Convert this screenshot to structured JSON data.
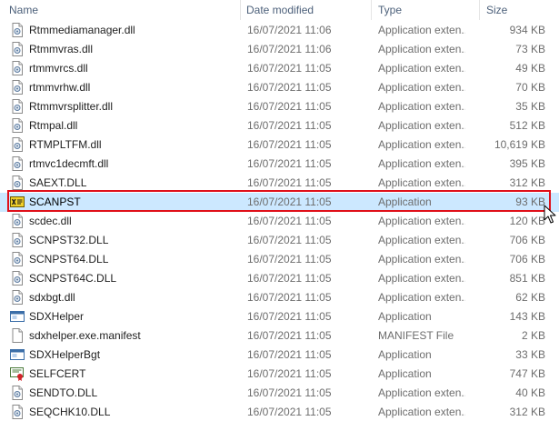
{
  "columns": {
    "name": "Name",
    "date": "Date modified",
    "type": "Type",
    "size": "Size"
  },
  "files": [
    {
      "name": "Rtmmediamanager.dll",
      "date": "16/07/2021 11:06",
      "type": "Application exten...",
      "size": "934 KB",
      "icon": "dll-gear-icon"
    },
    {
      "name": "Rtmmvras.dll",
      "date": "16/07/2021 11:06",
      "type": "Application exten...",
      "size": "73 KB",
      "icon": "dll-gear-icon"
    },
    {
      "name": "rtmmvrcs.dll",
      "date": "16/07/2021 11:05",
      "type": "Application exten...",
      "size": "49 KB",
      "icon": "dll-gear-icon"
    },
    {
      "name": "rtmmvrhw.dll",
      "date": "16/07/2021 11:05",
      "type": "Application exten...",
      "size": "70 KB",
      "icon": "dll-gear-icon"
    },
    {
      "name": "Rtmmvrsplitter.dll",
      "date": "16/07/2021 11:05",
      "type": "Application exten...",
      "size": "35 KB",
      "icon": "dll-gear-icon"
    },
    {
      "name": "Rtmpal.dll",
      "date": "16/07/2021 11:05",
      "type": "Application exten...",
      "size": "512 KB",
      "icon": "dll-gear-icon"
    },
    {
      "name": "RTMPLTFM.dll",
      "date": "16/07/2021 11:05",
      "type": "Application exten...",
      "size": "10,619 KB",
      "icon": "dll-gear-icon"
    },
    {
      "name": "rtmvc1decmft.dll",
      "date": "16/07/2021 11:05",
      "type": "Application exten...",
      "size": "395 KB",
      "icon": "dll-gear-icon"
    },
    {
      "name": "SAEXT.DLL",
      "date": "16/07/2021 11:05",
      "type": "Application exten...",
      "size": "312 KB",
      "icon": "dll-gear-icon"
    },
    {
      "name": "SCANPST",
      "date": "16/07/2021 11:05",
      "type": "Application",
      "size": "93 KB",
      "icon": "scanpst-app-icon",
      "selected": true
    },
    {
      "name": "scdec.dll",
      "date": "16/07/2021 11:05",
      "type": "Application exten...",
      "size": "120 KB",
      "icon": "dll-gear-icon"
    },
    {
      "name": "SCNPST32.DLL",
      "date": "16/07/2021 11:05",
      "type": "Application exten...",
      "size": "706 KB",
      "icon": "dll-gear-icon"
    },
    {
      "name": "SCNPST64.DLL",
      "date": "16/07/2021 11:05",
      "type": "Application exten...",
      "size": "706 KB",
      "icon": "dll-gear-icon"
    },
    {
      "name": "SCNPST64C.DLL",
      "date": "16/07/2021 11:05",
      "type": "Application exten...",
      "size": "851 KB",
      "icon": "dll-gear-icon"
    },
    {
      "name": "sdxbgt.dll",
      "date": "16/07/2021 11:05",
      "type": "Application exten...",
      "size": "62 KB",
      "icon": "dll-gear-icon"
    },
    {
      "name": "SDXHelper",
      "date": "16/07/2021 11:05",
      "type": "Application",
      "size": "143 KB",
      "icon": "app-window-icon"
    },
    {
      "name": "sdxhelper.exe.manifest",
      "date": "16/07/2021 11:05",
      "type": "MANIFEST File",
      "size": "2 KB",
      "icon": "blank-document-icon"
    },
    {
      "name": "SDXHelperBgt",
      "date": "16/07/2021 11:05",
      "type": "Application",
      "size": "33 KB",
      "icon": "app-window-icon"
    },
    {
      "name": "SELFCERT",
      "date": "16/07/2021 11:05",
      "type": "Application",
      "size": "747 KB",
      "icon": "certificate-app-icon"
    },
    {
      "name": "SENDTO.DLL",
      "date": "16/07/2021 11:05",
      "type": "Application exten...",
      "size": "40 KB",
      "icon": "dll-gear-icon"
    },
    {
      "name": "SEQCHK10.DLL",
      "date": "16/07/2021 11:05",
      "type": "Application exten...",
      "size": "312 KB",
      "icon": "dll-gear-icon"
    }
  ],
  "colors": {
    "selection_bg": "#cce8ff",
    "highlight_border": "#e0101a",
    "header_text": "#4c607a",
    "detail_text": "#6d6d6d"
  }
}
